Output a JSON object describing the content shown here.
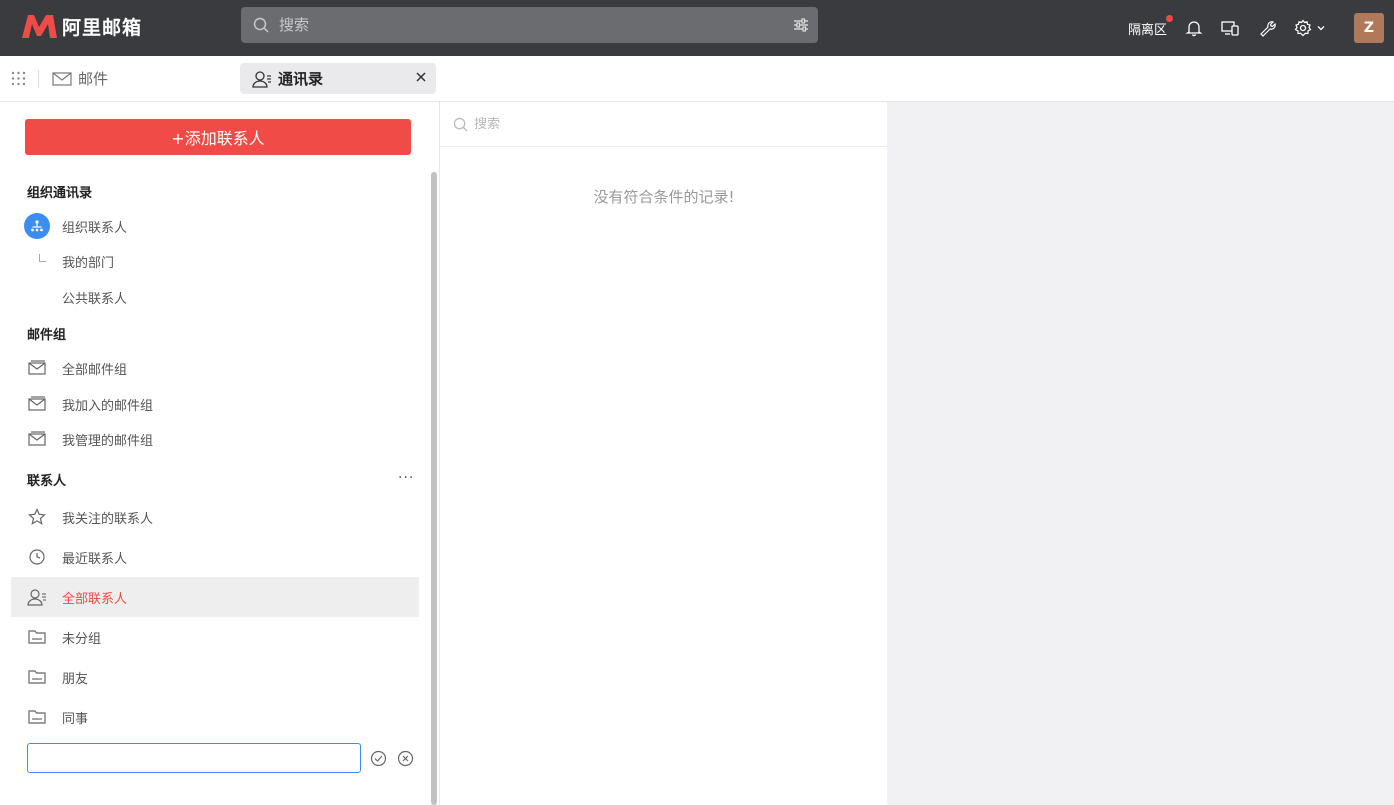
{
  "header": {
    "logo_text": "阿里邮箱",
    "search_placeholder": "搜索",
    "quarantine_label": "隔离区",
    "avatar_letter": "Z"
  },
  "tabs": {
    "mail_label": "邮件",
    "contacts_label": "通讯录"
  },
  "sidebar": {
    "add_button_label": "+添加联系人",
    "sections": {
      "org": "组织通讯录",
      "groups": "邮件组",
      "contacts": "联系人"
    },
    "org_items": [
      "组织联系人",
      "我的部门",
      "公共联系人"
    ],
    "group_items": [
      "全部邮件组",
      "我加入的邮件组",
      "我管理的邮件组"
    ],
    "contact_items": [
      "我关注的联系人",
      "最近联系人",
      "全部联系人",
      "未分组",
      "朋友",
      "同事"
    ],
    "more_label": "···",
    "new_group_value": ""
  },
  "list": {
    "search_placeholder": "搜索",
    "empty_text": "没有符合条件的记录!"
  },
  "colors": {
    "accent": "#f04b46",
    "topbar": "#393b3f",
    "focus": "#3b8ef0"
  }
}
